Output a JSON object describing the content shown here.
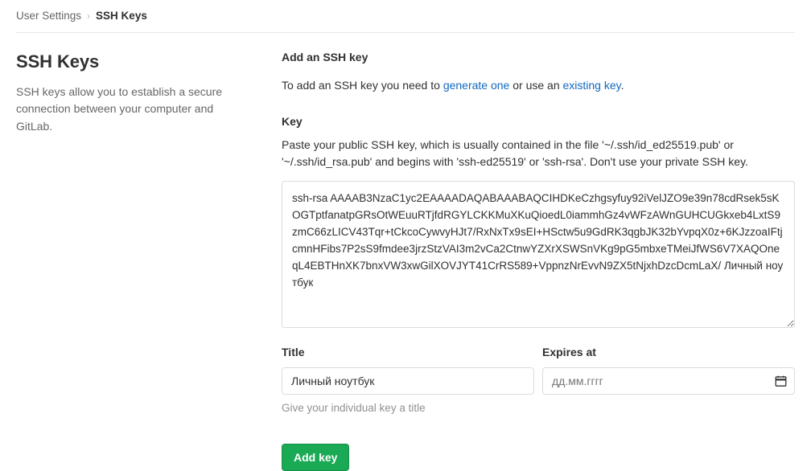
{
  "breadcrumb": {
    "parent": "User Settings",
    "separator": "›",
    "current": "SSH Keys"
  },
  "sidebar": {
    "title": "SSH Keys",
    "description": "SSH keys allow you to establish a secure connection between your computer and GitLab."
  },
  "main": {
    "section_title": "Add an SSH key",
    "intro_prefix": "To add an SSH key you need to ",
    "intro_link_generate": "generate one",
    "intro_middle": " or use an ",
    "intro_link_existing": "existing key",
    "intro_suffix": ".",
    "key_label": "Key",
    "key_help": "Paste your public SSH key, which is usually contained in the file '~/.ssh/id_ed25519.pub' or '~/.ssh/id_rsa.pub' and begins with 'ssh-ed25519' or 'ssh-rsa'. Don't use your private SSH key.",
    "key_value": "ssh-rsa AAAAB3NzaC1yc2EAAAADAQABAAABAQCIHDKeCzhgsyfuy92iVelJZO9e39n78cdRsek5sKOGTptfanatpGRsOtWEuuRTjfdRGYLCKKMuXKuQioedL0iammhGz4vWFzAWnGUHCUGkxeb4LxtS9zmC66zLICV43Tqr+tCkcoCywvyHJt7/RxNxTx9sEI+HSctw5u9GdRK3qgbJK32bYvpqX0z+6KJzzoaIFtjcmnHFibs7P2sS9fmdee3jrzStzVAI3m2vCa2CtnwYZXrXSWSnVKg9pG5mbxeTMeiJfWS6V7XAQOneqL4EBTHnXK7bnxVW3xwGilXOVJYT41CrRS589+VppnzNrEvvN9ZX5tNjxhDzcDcmLaX/ Личный ноутбук",
    "title_label": "Title",
    "title_value": "Личный ноутбук",
    "title_help": "Give your individual key a title",
    "expires_label": "Expires at",
    "expires_placeholder": "дд.мм.гггг",
    "expires_value": "",
    "calendar_icon": "calendar-icon",
    "submit_label": "Add key"
  },
  "colors": {
    "brand_green": "#1aaa55",
    "link_blue": "#1068bf",
    "text": "#303030",
    "muted": "#919191",
    "border": "#dbdbdb"
  }
}
